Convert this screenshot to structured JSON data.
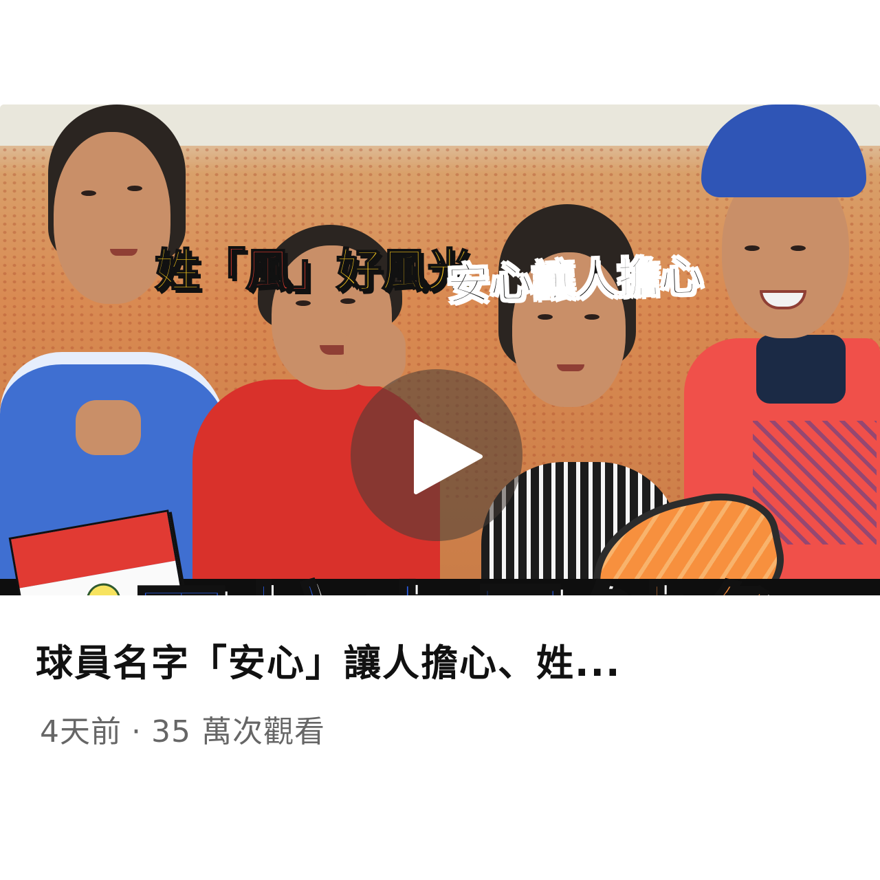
{
  "thumbnail": {
    "caption_line1_pre": "姓",
    "caption_line1_highlight": "「風」",
    "caption_line1_post": "好風光",
    "caption_line2": "安心讓人擔心",
    "big_title_blue": "巴拉圭是",
    "big_title_orange": "鮭魚",
    "big_title_mark": "？",
    "flag_icon": "paraguay-flag-icon",
    "play_icon": "play-icon",
    "colors": {
      "title_blue": "#2b5fe8",
      "title_orange": "#f28b3c",
      "caption_yellow": "#f2c31b",
      "strip_black": "#0e0e0e"
    }
  },
  "video": {
    "title": "球員名字「安心」讓人擔心、姓...",
    "age": "4天前",
    "separator": "·",
    "views": "35 萬次觀看"
  }
}
